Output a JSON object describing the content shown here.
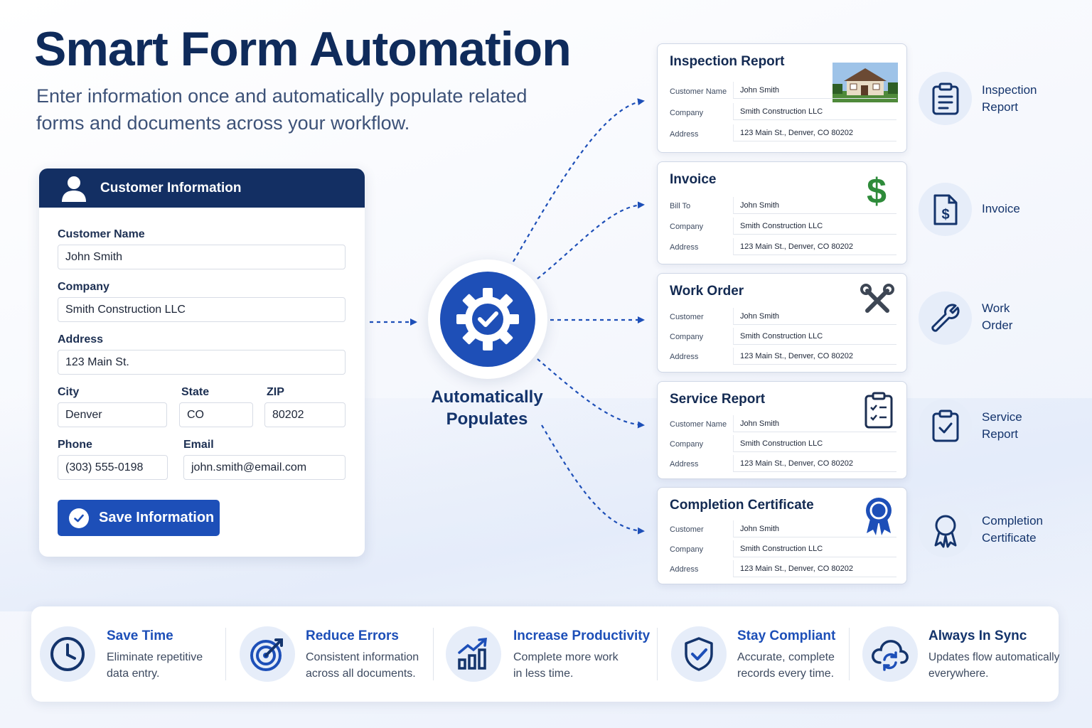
{
  "header": {
    "title": "Smart Form Automation",
    "subtitle": "Enter information once and automatically populate related forms and documents across your workflow."
  },
  "customer_form": {
    "title": "Customer Information",
    "fields": {
      "name": {
        "label": "Customer Name",
        "value": "John Smith"
      },
      "company": {
        "label": "Company",
        "value": "Smith Construction LLC"
      },
      "address": {
        "label": "Address",
        "value": "123 Main St."
      },
      "city": {
        "label": "City",
        "value": "Denver"
      },
      "state": {
        "label": "State",
        "value": "CO"
      },
      "zip": {
        "label": "ZIP",
        "value": "80202"
      },
      "phone": {
        "label": "Phone",
        "value": "(303) 555-0198"
      },
      "email": {
        "label": "Email",
        "value": "john.smith@email.com"
      }
    },
    "save_label": "Save Information"
  },
  "hub": {
    "line1": "Automatically",
    "line2": "Populates"
  },
  "documents": [
    {
      "title": "Inspection Report",
      "rows": [
        {
          "label": "Customer Name",
          "value": "John Smith"
        },
        {
          "label": "Company",
          "value": "Smith Construction LLC"
        },
        {
          "label": "Address",
          "value": "123 Main St., Denver, CO 80202"
        }
      ],
      "icon": "house-photo-icon",
      "side_line1": "Inspection",
      "side_line2": "Report"
    },
    {
      "title": "Invoice",
      "rows": [
        {
          "label": "Bill To",
          "value": "John Smith"
        },
        {
          "label": "Company",
          "value": "Smith Construction LLC"
        },
        {
          "label": "Address",
          "value": "123 Main St., Denver, CO 80202"
        }
      ],
      "icon": "dollar-icon",
      "side_line1": "Invoice",
      "side_line2": ""
    },
    {
      "title": "Work Order",
      "rows": [
        {
          "label": "Customer",
          "value": "John Smith"
        },
        {
          "label": "Company",
          "value": "Smith Construction LLC"
        },
        {
          "label": "Address",
          "value": "123 Main St., Denver, CO 80202"
        }
      ],
      "icon": "tools-icon",
      "side_line1": "Work",
      "side_line2": "Order"
    },
    {
      "title": "Service Report",
      "rows": [
        {
          "label": "Customer Name",
          "value": "John Smith"
        },
        {
          "label": "Company",
          "value": "Smith Construction LLC"
        },
        {
          "label": "Address",
          "value": "123 Main St., Denver, CO 80202"
        }
      ],
      "icon": "clipboard-check-icon",
      "side_line1": "Service",
      "side_line2": "Report"
    },
    {
      "title": "Completion Certificate",
      "rows": [
        {
          "label": "Customer",
          "value": "John Smith"
        },
        {
          "label": "Company",
          "value": "Smith Construction LLC"
        },
        {
          "label": "Address",
          "value": "123 Main St., Denver, CO 80202"
        }
      ],
      "icon": "award-ribbon-icon",
      "side_line1": "Completion",
      "side_line2": "Certificate"
    }
  ],
  "benefits": [
    {
      "title": "Save Time",
      "desc1": "Eliminate repetitive",
      "desc2": "data entry.",
      "icon": "clock-icon"
    },
    {
      "title": "Reduce Errors",
      "desc1": "Consistent information",
      "desc2": "across all documents.",
      "icon": "target-icon"
    },
    {
      "title": "Increase Productivity",
      "desc1": "Complete more work",
      "desc2": "in less time.",
      "icon": "growth-chart-icon"
    },
    {
      "title": "Stay Compliant",
      "desc1": "Accurate, complete",
      "desc2": "records every time.",
      "icon": "shield-check-icon"
    },
    {
      "title": "Always In Sync",
      "desc1": "Updates flow automatically",
      "desc2": "everywhere.",
      "icon": "cloud-sync-icon"
    }
  ],
  "colors": {
    "navy": "#0f2b5b",
    "accent_blue": "#1d4fb8",
    "dollar_green": "#2e8b3a"
  }
}
